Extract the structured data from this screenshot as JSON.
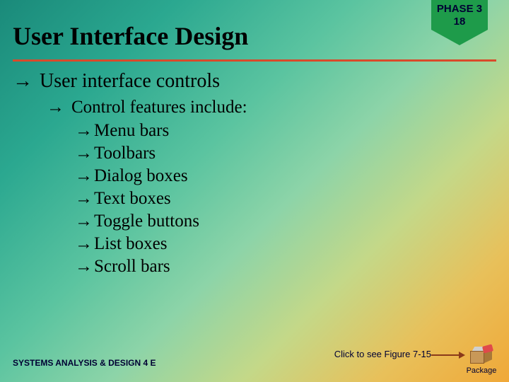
{
  "title": "User Interface Design",
  "phase": {
    "line1": "PHASE 3",
    "line2": "18"
  },
  "content": {
    "lvl1": "User interface controls",
    "lvl2": "Control features include:",
    "lvl3": [
      "Menu bars",
      "Toolbars",
      "Dialog boxes",
      "Text boxes",
      "Toggle buttons",
      "List boxes",
      "Scroll bars"
    ]
  },
  "bullet": "→",
  "footer": "SYSTEMS ANALYSIS & DESIGN 4 E",
  "figure_link": "Click to see Figure 7-15",
  "package_label": "Package"
}
